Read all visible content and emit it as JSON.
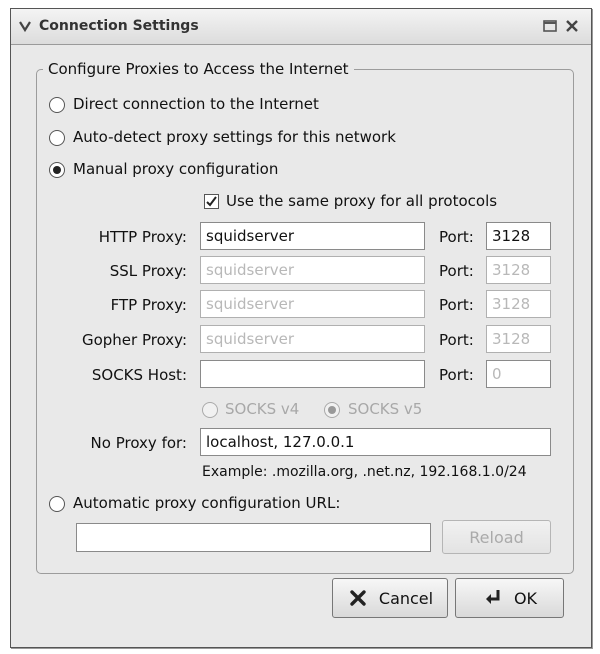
{
  "window": {
    "title": "Connection Settings"
  },
  "group": {
    "legend": "Configure Proxies to Access the Internet"
  },
  "radios": {
    "direct": "Direct connection to the Internet",
    "auto_detect": "Auto-detect proxy settings for this network",
    "manual": "Manual proxy configuration",
    "auto_url": "Automatic proxy configuration URL:"
  },
  "same_proxy": {
    "label": "Use the same proxy for all protocols",
    "checked": true
  },
  "proxies": {
    "http": {
      "label": "HTTP Proxy:",
      "value": "squidserver",
      "port_label": "Port:",
      "port": "3128"
    },
    "ssl": {
      "label": "SSL Proxy:",
      "value": "squidserver",
      "port_label": "Port:",
      "port": "3128"
    },
    "ftp": {
      "label": "FTP Proxy:",
      "value": "squidserver",
      "port_label": "Port:",
      "port": "3128"
    },
    "gopher": {
      "label": "Gopher Proxy:",
      "value": "squidserver",
      "port_label": "Port:",
      "port": "3128"
    },
    "socks": {
      "label": "SOCKS Host:",
      "value": "",
      "port_label": "Port:",
      "port": "0"
    }
  },
  "socks_version": {
    "v4": "SOCKS v4",
    "v5": "SOCKS v5",
    "selected": "v5"
  },
  "no_proxy": {
    "label": "No Proxy for:",
    "value": "localhost, 127.0.0.1",
    "example": "Example: .mozilla.org, .net.nz, 192.168.1.0/24"
  },
  "auto_url": {
    "value": "",
    "reload_label": "Reload"
  },
  "buttons": {
    "cancel": "Cancel",
    "ok": "OK"
  }
}
